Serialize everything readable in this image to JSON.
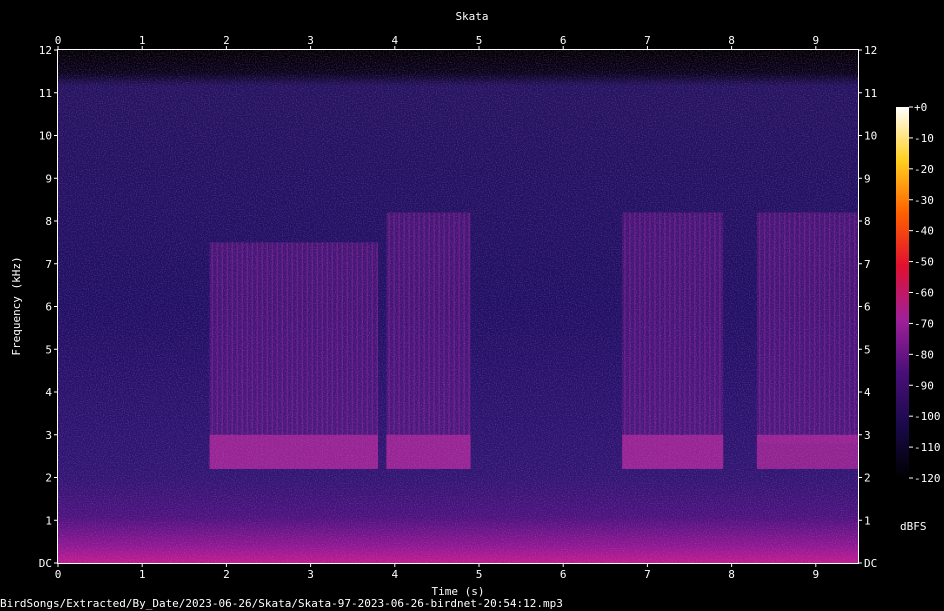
{
  "chart_data": {
    "type": "heatmap",
    "title": "Skata",
    "xlabel": "Time (s)",
    "ylabel": "Frequency (kHz)",
    "xlim": [
      0,
      9.5
    ],
    "ylim": [
      0,
      12
    ],
    "x_ticks": [
      "0",
      "1",
      "2",
      "3",
      "4",
      "5",
      "6",
      "7",
      "8",
      "9"
    ],
    "y_ticks": [
      "DC",
      "1",
      "2",
      "3",
      "4",
      "5",
      "6",
      "7",
      "8",
      "9",
      "10",
      "11",
      "12"
    ],
    "colorbar": {
      "label": "dBFS",
      "ticks": [
        "+0",
        "-10",
        "-20",
        "-30",
        "-40",
        "-50",
        "-60",
        "-70",
        "-80",
        "-90",
        "-100",
        "-110",
        "-120"
      ],
      "range": [
        -120,
        0
      ],
      "colors": [
        "#000000",
        "#1a0a4a",
        "#4a0f7a",
        "#a0209a",
        "#e01030",
        "#ff6000",
        "#ffd020",
        "#ffffff"
      ]
    },
    "colors": {
      "background": "#000000",
      "floor": "#1c1060",
      "upper_noise": "#2a1c6e",
      "high_energy": "#b02a9a"
    },
    "bursts": [
      {
        "start": 1.8,
        "end": 3.8,
        "low_khz": 2.2,
        "high_khz": 7.5
      },
      {
        "start": 3.9,
        "end": 4.9,
        "low_khz": 2.2,
        "high_khz": 8.2
      },
      {
        "start": 6.7,
        "end": 7.9,
        "low_khz": 2.2,
        "high_khz": 8.2
      },
      {
        "start": 8.3,
        "end": 9.5,
        "low_khz": 2.8,
        "high_khz": 8.2
      }
    ]
  },
  "footer": {
    "filename": "BirdSongs/Extracted/By_Date/2023-06-26/Skata/Skata-97-2023-06-26-birdnet-20:54:12.mp3"
  }
}
